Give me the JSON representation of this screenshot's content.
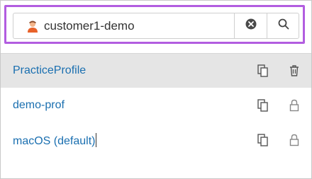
{
  "search": {
    "value": "customer1-demo",
    "clear_icon": "clear-circle-x-icon",
    "search_icon": "magnifier-icon"
  },
  "profiles": [
    {
      "label": "PracticeProfile",
      "selected": true,
      "copy_icon": "duplicate-icon",
      "action_icon": "trash-icon"
    },
    {
      "label": "demo-prof",
      "selected": false,
      "copy_icon": "duplicate-icon",
      "action_icon": "lock-icon"
    },
    {
      "label": "macOS (default)",
      "selected": false,
      "copy_icon": "duplicate-icon",
      "action_icon": "lock-icon"
    }
  ],
  "colors": {
    "highlight": "#b25de0",
    "link": "#1a6fb0",
    "selected_row": "#e5e5e5"
  }
}
